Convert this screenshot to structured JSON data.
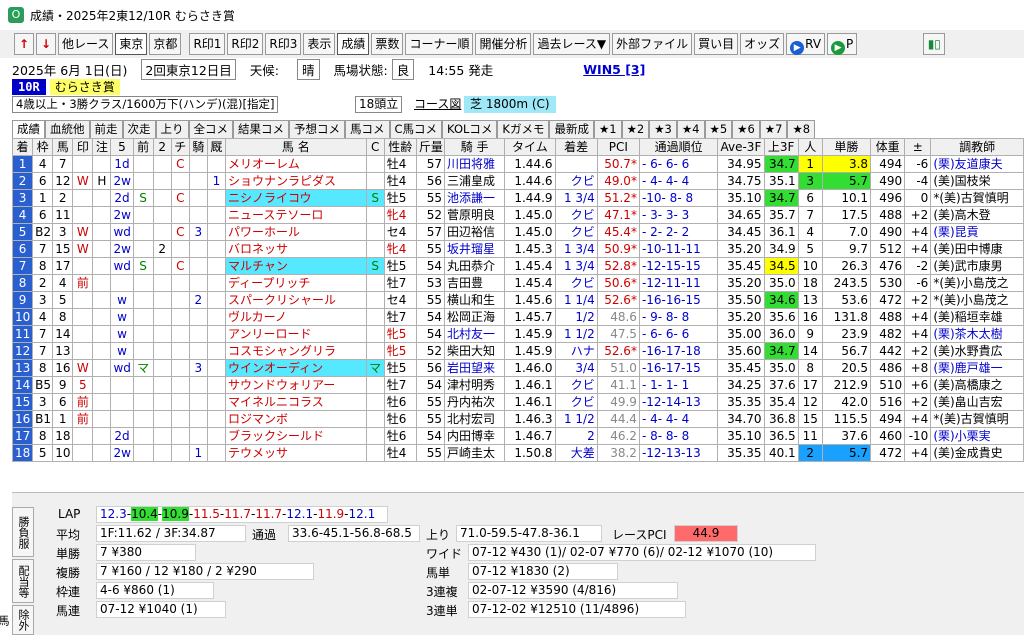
{
  "window": {
    "title": "成績・2025年2東12/10R むらさき賞"
  },
  "toolbar": {
    "prev_label": "↑",
    "next_label": "↓",
    "other_race": "他レース",
    "tokyo": "東京",
    "kyoto": "京都",
    "r1": "R印1",
    "r2": "R印2",
    "r3": "R印3",
    "display": "表示",
    "results": "成績",
    "votes": "票数",
    "corner": "コーナー順",
    "analysis": "開催分析",
    "past": "過去レース▼",
    "external": "外部ファイル",
    "buy": "買い目",
    "odds": "オッズ",
    "rv": "RV",
    "p": "P"
  },
  "info": {
    "date": "2025年 6月 1日(日)",
    "meet": "2回東京12日目",
    "weather_label": "天候:",
    "weather": "晴",
    "track_label": "馬場状態:",
    "track": "良",
    "start": "14:55 発走",
    "win5": "WIN5 [3]",
    "race_no": "10R",
    "race_name": "むらさき賞",
    "conditions": "4歳以上・3勝クラス/1600万下(ハンデ)(混)[指定]",
    "heads": "18頭立",
    "course_fig": "コース図",
    "course": "芝 1800m (C)"
  },
  "tabs": [
    "成績",
    "血統他",
    "前走",
    "次走",
    "上り",
    "全コメ",
    "結果コメ",
    "予想コメ",
    "馬コメ",
    "C馬コメ",
    "KOLコメ",
    "Kガメモ",
    "最新成",
    "★1",
    "★2",
    "★3",
    "★4",
    "★5",
    "★6",
    "★7",
    "★8"
  ],
  "columns": [
    "着",
    "枠",
    "馬",
    "印",
    "注",
    "5",
    "前",
    "2",
    "チ",
    "騎",
    "厩",
    "馬 名",
    "C",
    "性齢",
    "斤量",
    "騎 手",
    "タイム",
    "着差",
    "PCI",
    "通過順位",
    "Ave-3F",
    "上3F",
    "人",
    "単勝",
    "体重",
    "±",
    "調教師"
  ],
  "rows": [
    {
      "pos": "1",
      "gate": "4",
      "num": "7",
      "mark": "",
      "note": "",
      "five": "1d",
      "prev": "",
      "two": "",
      "chi": "C",
      "ki": "",
      "kyu": "",
      "name": "メリオーレム",
      "cflag": "",
      "sex": "牡4",
      "wt": "57",
      "jockey": "川田将雅",
      "time": "1.44.6",
      "margin": "",
      "pci": "50.7*",
      "pass": "- 6- 6- 6",
      "ave": "34.95",
      "l3f": "34.7",
      "pop": "1",
      "odds": "3.8",
      "body": "494",
      "diff": "-6",
      "trainer": "(栗)友道康夫"
    },
    {
      "pos": "2",
      "gate": "6",
      "num": "12",
      "mark": "W",
      "note": "H",
      "five": "2w",
      "prev": "",
      "two": "",
      "chi": "",
      "ki": "",
      "kyu": "1",
      "name": "ショウナンラピダス",
      "cflag": "",
      "sex": "牡4",
      "wt": "56",
      "jockey": "三浦皇成",
      "time": "1.44.6",
      "margin": "クビ",
      "pci": "49.0*",
      "pass": "- 4- 4- 4",
      "ave": "34.75",
      "l3f": "35.1",
      "pop": "3",
      "odds": "5.7",
      "body": "490",
      "diff": "-4",
      "trainer": "(美)国枝栄"
    },
    {
      "pos": "3",
      "gate": "1",
      "num": "2",
      "mark": "",
      "note": "",
      "five": "2d",
      "prev": "S",
      "two": "",
      "chi": "C",
      "ki": "",
      "kyu": "",
      "name": "ニシノライコウ",
      "cflag": "S",
      "sex": "牡5",
      "wt": "55",
      "jockey": "池添謙一",
      "time": "1.44.9",
      "margin": "1 3/4",
      "pci": "51.2*",
      "pass": "-10- 8- 8",
      "ave": "35.10",
      "l3f": "34.7",
      "pop": "6",
      "odds": "10.1",
      "body": "496",
      "diff": "0",
      "trainer": "*(美)古賀慎明"
    },
    {
      "pos": "4",
      "gate": "6",
      "num": "11",
      "mark": "",
      "note": "",
      "five": "2w",
      "prev": "",
      "two": "",
      "chi": "",
      "ki": "",
      "kyu": "",
      "name": "ニューステソーロ",
      "cflag": "",
      "sex": "牝4",
      "wt": "52",
      "jockey": "菅原明良",
      "time": "1.45.0",
      "margin": "クビ",
      "pci": "47.1*",
      "pass": "- 3- 3- 3",
      "ave": "34.65",
      "l3f": "35.7",
      "pop": "7",
      "odds": "17.5",
      "body": "488",
      "diff": "+2",
      "trainer": "(美)高木登"
    },
    {
      "pos": "5",
      "gate": "B2",
      "num": "3",
      "mark": "W",
      "note": "",
      "five": "wd",
      "prev": "",
      "two": "",
      "chi": "C",
      "ki": "3",
      "kyu": "",
      "name": "パワーホール",
      "cflag": "",
      "sex": "セ4",
      "wt": "57",
      "jockey": "田辺裕信",
      "time": "1.45.0",
      "margin": "クビ",
      "pci": "45.4*",
      "pass": "- 2- 2- 2",
      "ave": "34.45",
      "l3f": "36.1",
      "pop": "4",
      "odds": "7.0",
      "body": "490",
      "diff": "+4",
      "trainer": "(栗)昆貢"
    },
    {
      "pos": "6",
      "gate": "7",
      "num": "15",
      "mark": "W",
      "note": "",
      "five": "2w",
      "prev": "",
      "two": "2",
      "chi": "",
      "ki": "",
      "kyu": "",
      "name": "バロネッサ",
      "cflag": "",
      "sex": "牝4",
      "wt": "55",
      "jockey": "坂井瑠星",
      "time": "1.45.3",
      "margin": "1 3/4",
      "pci": "50.9*",
      "pass": "-10-11-11",
      "ave": "35.20",
      "l3f": "34.9",
      "pop": "5",
      "odds": "9.7",
      "body": "512",
      "diff": "+4",
      "trainer": "(美)田中博康"
    },
    {
      "pos": "7",
      "gate": "8",
      "num": "17",
      "mark": "",
      "note": "",
      "five": "wd",
      "prev": "S",
      "two": "",
      "chi": "C",
      "ki": "",
      "kyu": "",
      "name": "マルチャン",
      "cflag": "S",
      "sex": "牡5",
      "wt": "54",
      "jockey": "丸田恭介",
      "time": "1.45.4",
      "margin": "1 3/4",
      "pci": "52.8*",
      "pass": "-12-15-15",
      "ave": "35.45",
      "l3f": "34.5",
      "pop": "10",
      "odds": "26.3",
      "body": "476",
      "diff": "-2",
      "trainer": "(美)武市康男"
    },
    {
      "pos": "8",
      "gate": "2",
      "num": "4",
      "mark": "前",
      "note": "",
      "five": "",
      "prev": "",
      "two": "",
      "chi": "",
      "ki": "",
      "kyu": "",
      "name": "ディープリッチ",
      "cflag": "",
      "sex": "牡7",
      "wt": "53",
      "jockey": "吉田豊",
      "time": "1.45.4",
      "margin": "クビ",
      "pci": "50.6*",
      "pass": "-12-11-11",
      "ave": "35.20",
      "l3f": "35.0",
      "pop": "18",
      "odds": "243.5",
      "body": "530",
      "diff": "-6",
      "trainer": "*(美)小島茂之"
    },
    {
      "pos": "9",
      "gate": "3",
      "num": "5",
      "mark": "",
      "note": "",
      "five": "w",
      "prev": "",
      "two": "",
      "chi": "",
      "ki": "2",
      "kyu": "",
      "name": "スパークリシャール",
      "cflag": "",
      "sex": "セ4",
      "wt": "55",
      "jockey": "横山和生",
      "time": "1.45.6",
      "margin": "1 1/4",
      "pci": "52.6*",
      "pass": "-16-16-15",
      "ave": "35.50",
      "l3f": "34.6",
      "pop": "13",
      "odds": "53.6",
      "body": "472",
      "diff": "+2",
      "trainer": "*(美)小島茂之"
    },
    {
      "pos": "10",
      "gate": "4",
      "num": "8",
      "mark": "",
      "note": "",
      "five": "w",
      "prev": "",
      "two": "",
      "chi": "",
      "ki": "",
      "kyu": "",
      "name": "ヴルカーノ",
      "cflag": "",
      "sex": "牡7",
      "wt": "54",
      "jockey": "松岡正海",
      "time": "1.45.7",
      "margin": "1/2",
      "pci": "48.6",
      "pass": "- 9- 8- 8",
      "ave": "35.20",
      "l3f": "35.6",
      "pop": "16",
      "odds": "131.8",
      "body": "488",
      "diff": "+4",
      "trainer": "(美)稲垣幸雄"
    },
    {
      "pos": "11",
      "gate": "7",
      "num": "14",
      "mark": "",
      "note": "",
      "five": "w",
      "prev": "",
      "two": "",
      "chi": "",
      "ki": "",
      "kyu": "",
      "name": "アンリーロード",
      "cflag": "",
      "sex": "牝5",
      "wt": "54",
      "jockey": "北村友一",
      "time": "1.45.9",
      "margin": "1 1/2",
      "pci": "47.5",
      "pass": "- 6- 6- 6",
      "ave": "35.00",
      "l3f": "36.0",
      "pop": "9",
      "odds": "23.9",
      "body": "482",
      "diff": "+4",
      "trainer": "(栗)茶木太樹"
    },
    {
      "pos": "12",
      "gate": "7",
      "num": "13",
      "mark": "",
      "note": "",
      "five": "w",
      "prev": "",
      "two": "",
      "chi": "",
      "ki": "",
      "kyu": "",
      "name": "コスモシャングリラ",
      "cflag": "",
      "sex": "牝5",
      "wt": "52",
      "jockey": "柴田大知",
      "time": "1.45.9",
      "margin": "ハナ",
      "pci": "52.6*",
      "pass": "-16-17-18",
      "ave": "35.60",
      "l3f": "34.7",
      "pop": "14",
      "odds": "56.7",
      "body": "442",
      "diff": "+2",
      "trainer": "(美)水野貴広"
    },
    {
      "pos": "13",
      "gate": "8",
      "num": "16",
      "mark": "W",
      "note": "",
      "five": "wd",
      "prev": "マ",
      "two": "",
      "chi": "",
      "ki": "3",
      "kyu": "",
      "name": "ウインオーディン",
      "cflag": "マ",
      "sex": "牡5",
      "wt": "56",
      "jockey": "岩田望来",
      "time": "1.46.0",
      "margin": "3/4",
      "pci": "51.0",
      "pass": "-16-17-15",
      "ave": "35.45",
      "l3f": "35.0",
      "pop": "8",
      "odds": "20.5",
      "body": "486",
      "diff": "+8",
      "trainer": "(栗)鹿戸雄一"
    },
    {
      "pos": "14",
      "gate": "B5",
      "num": "9",
      "mark": "5",
      "note": "",
      "five": "",
      "prev": "",
      "two": "",
      "chi": "",
      "ki": "",
      "kyu": "",
      "name": "サウンドウォリアー",
      "cflag": "",
      "sex": "牡7",
      "wt": "54",
      "jockey": "津村明秀",
      "time": "1.46.1",
      "margin": "クビ",
      "pci": "41.1",
      "pass": "- 1- 1- 1",
      "ave": "34.25",
      "l3f": "37.6",
      "pop": "17",
      "odds": "212.9",
      "body": "510",
      "diff": "+6",
      "trainer": "(美)高橋康之"
    },
    {
      "pos": "15",
      "gate": "3",
      "num": "6",
      "mark": "前",
      "note": "",
      "five": "",
      "prev": "",
      "two": "",
      "chi": "",
      "ki": "",
      "kyu": "",
      "name": "マイネルニコラス",
      "cflag": "",
      "sex": "牡6",
      "wt": "55",
      "jockey": "丹内祐次",
      "time": "1.46.1",
      "margin": "クビ",
      "pci": "49.9",
      "pass": "-12-14-13",
      "ave": "35.35",
      "l3f": "35.4",
      "pop": "12",
      "odds": "42.0",
      "body": "516",
      "diff": "+2",
      "trainer": "(美)畠山吉宏"
    },
    {
      "pos": "16",
      "gate": "B1",
      "num": "1",
      "mark": "前",
      "note": "",
      "five": "",
      "prev": "",
      "two": "",
      "chi": "",
      "ki": "",
      "kyu": "",
      "name": "ロジマンボ",
      "cflag": "",
      "sex": "牡6",
      "wt": "55",
      "jockey": "北村宏司",
      "time": "1.46.3",
      "margin": "1 1/2",
      "pci": "44.4",
      "pass": "- 4- 4- 4",
      "ave": "34.70",
      "l3f": "36.8",
      "pop": "15",
      "odds": "115.5",
      "body": "494",
      "diff": "+4",
      "trainer": "*(美)古賀慎明"
    },
    {
      "pos": "17",
      "gate": "8",
      "num": "18",
      "mark": "",
      "note": "",
      "five": "2d",
      "prev": "",
      "two": "",
      "chi": "",
      "ki": "",
      "kyu": "",
      "name": "ブラックシールド",
      "cflag": "",
      "sex": "牡6",
      "wt": "54",
      "jockey": "内田博幸",
      "time": "1.46.7",
      "margin": "2",
      "pci": "46.2",
      "pass": "- 8- 8- 8",
      "ave": "35.10",
      "l3f": "36.5",
      "pop": "11",
      "odds": "37.6",
      "body": "460",
      "diff": "-10",
      "trainer": "(栗)小栗実"
    },
    {
      "pos": "18",
      "gate": "5",
      "num": "10",
      "mark": "",
      "note": "",
      "five": "2w",
      "prev": "",
      "two": "",
      "chi": "",
      "ki": "1",
      "kyu": "",
      "name": "テウメッサ",
      "cflag": "",
      "sex": "牡4",
      "wt": "55",
      "jockey": "戸崎圭太",
      "time": "1.50.8",
      "margin": "大差",
      "pci": "38.2",
      "pass": "-12-13-13",
      "ave": "35.35",
      "l3f": "40.1",
      "pop": "2",
      "odds": "5.7",
      "body": "472",
      "diff": "+4",
      "trainer": "(美)金成貴史"
    }
  ],
  "summary": {
    "vtab1": "勝負服",
    "vtab2": "配当等",
    "vtab3": "除外馬",
    "lap_label": "LAP",
    "lap": [
      "12.3",
      "10.4",
      "10.9",
      "11.5",
      "11.7",
      "11.7",
      "12.1",
      "11.9",
      "12.1"
    ],
    "avg_label": "平均",
    "avg": "1F:11.62 / 3F:34.87",
    "pass_label": "通過",
    "pass": "33.6-45.1-56.8-68.5",
    "last_label": "上り",
    "last": "71.0-59.5-47.8-36.1",
    "pci_label": "レースPCI",
    "pci": "44.9",
    "win_label": "単勝",
    "win": " 7 ¥380",
    "place_label": "複勝",
    "place": " 7 ¥160 / 12 ¥180 / 2 ¥290",
    "wide_label": "ワイド",
    "wide": "07-12 ¥430 (1)/ 02-07 ¥770 (6)/ 02-12 ¥1070 (10)",
    "bracket_label": "枠連",
    "bracket": "4-6 ¥860 (1)",
    "umatan_label": "馬単",
    "umatan": "07-12 ¥1830 (2)",
    "umaren_label": "馬連",
    "umaren": "07-12 ¥1040 (1)",
    "trio_label": "3連複",
    "trio": "02-07-12 ¥3590 (4/816)",
    "trifecta_label": "3連単",
    "trifecta": "07-12-02 ¥12510 (11/4896)"
  },
  "colors": {
    "gate": "#2a5fd0",
    "yellow": "#ffff00",
    "green": "#33dd33",
    "cyan": "#55e8ff",
    "pci_bar": "#ff6a6a"
  }
}
